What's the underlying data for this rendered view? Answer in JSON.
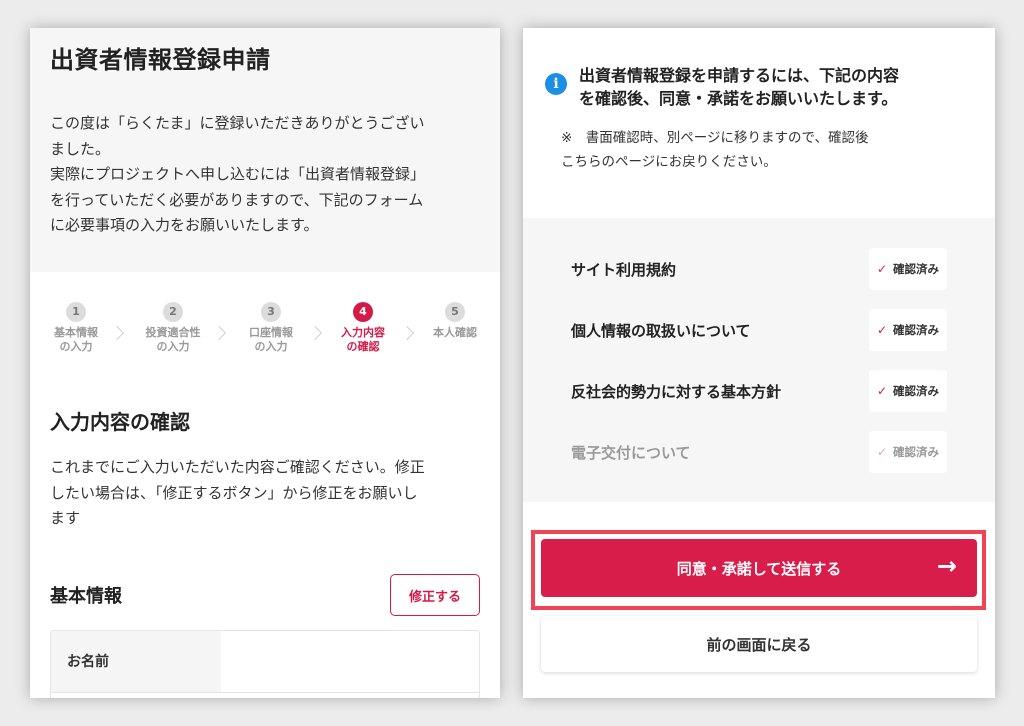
{
  "left": {
    "title": "出資者情報登録申請",
    "intro_lines": [
      "この度は「らくたま」に登録いただきありがとうござい",
      "ました。",
      "実際にプロジェクトへ申し込むには「出資者情報登録」",
      "を行っていただく必要がありますので、下記のフォーム",
      "に必要事項の入力をお願いいたします。"
    ],
    "steps": [
      {
        "num": "1",
        "label_line1": "基本情報",
        "label_line2": "の入力",
        "active": false
      },
      {
        "num": "2",
        "label_line1": "投資適合性",
        "label_line2": "の入力",
        "active": false
      },
      {
        "num": "3",
        "label_line1": "口座情報",
        "label_line2": "の入力",
        "active": false
      },
      {
        "num": "4",
        "label_line1": "入力内容",
        "label_line2": "の確認",
        "active": true
      },
      {
        "num": "5",
        "label_line1": "本人確認",
        "label_line2": "",
        "active": false
      }
    ],
    "confirm_title": "入力内容の確認",
    "confirm_lines": [
      "これまでにご入力いただいた内容ご確認ください。修正",
      "したい場合は、「修正するボタン」から修正をお願いし",
      "ます"
    ],
    "basic_info_title": "基本情報",
    "edit_button": "修正する",
    "name_label": "お名前"
  },
  "right": {
    "notice_title_line1": "出資者情報登録を申請するには、下記の内容",
    "notice_title_line2": "を確認後、同意・承諾をお願いいたします。",
    "info_icon_glyph": "i",
    "notice_note_line1": "※　書面確認時、別ページに移りますので、確認後",
    "notice_note_line2": "こちらのページにお戻りください。",
    "agreements": [
      {
        "label": "サイト利用規約",
        "status": "確認済み",
        "dim": false
      },
      {
        "label": "個人情報の取扱いについて",
        "status": "確認済み",
        "dim": false
      },
      {
        "label": "反社会的勢力に対する基本方針",
        "status": "確認済み",
        "dim": false
      },
      {
        "label": "電子交付について",
        "status": "確認済み",
        "dim": true
      }
    ],
    "check_glyph": "✓",
    "submit_button": "同意・承諾して送信する",
    "arrow_glyph": "→",
    "back_button": "前の画面に戻る"
  },
  "colors": {
    "accent": "#d61a48",
    "highlight": "#ef4453",
    "info": "#1a8fe3"
  },
  "icons": [
    "info-icon",
    "check-icon",
    "arrow-right-icon",
    "chevron-right-icon"
  ]
}
